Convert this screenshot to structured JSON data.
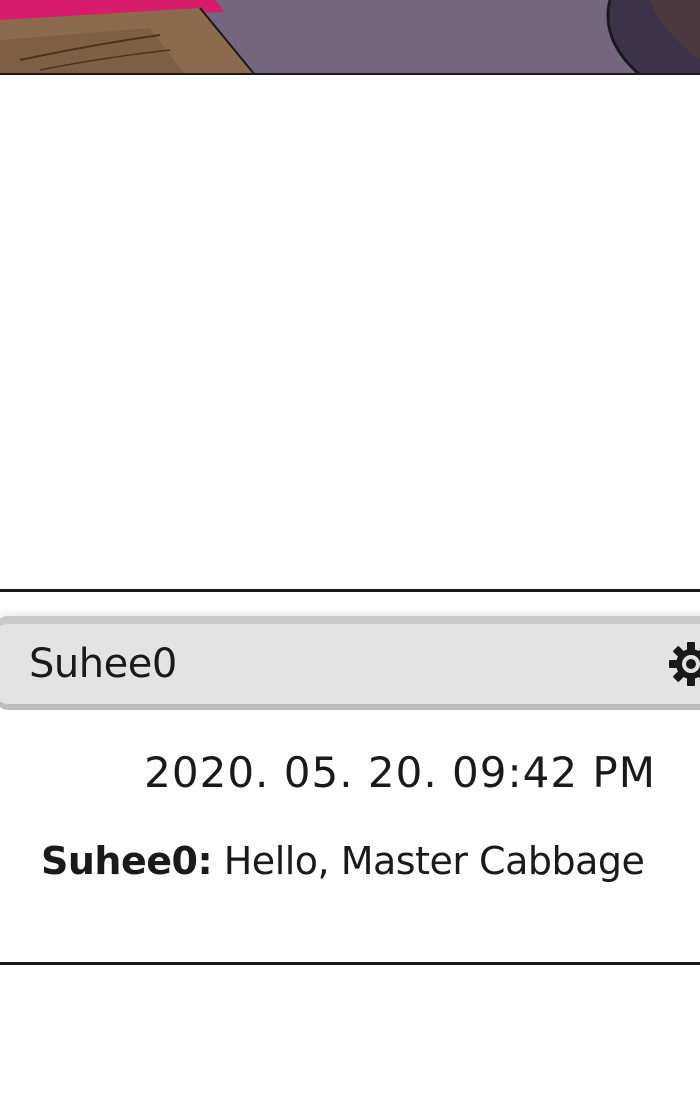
{
  "chat": {
    "header_title": "Suhee0",
    "settings_icon": "gear-icon",
    "timestamp": "2020. 05. 20. 09:42 PM",
    "message": {
      "sender": "Suhee0:",
      "text": " Hello, Master Cabbage"
    }
  },
  "colors": {
    "header_bg": "#e3e3e3",
    "text": "#1a1a1a",
    "border": "#1a1a1a",
    "panel_magenta": "#d81b6a",
    "panel_purple": "#6b5b73"
  }
}
